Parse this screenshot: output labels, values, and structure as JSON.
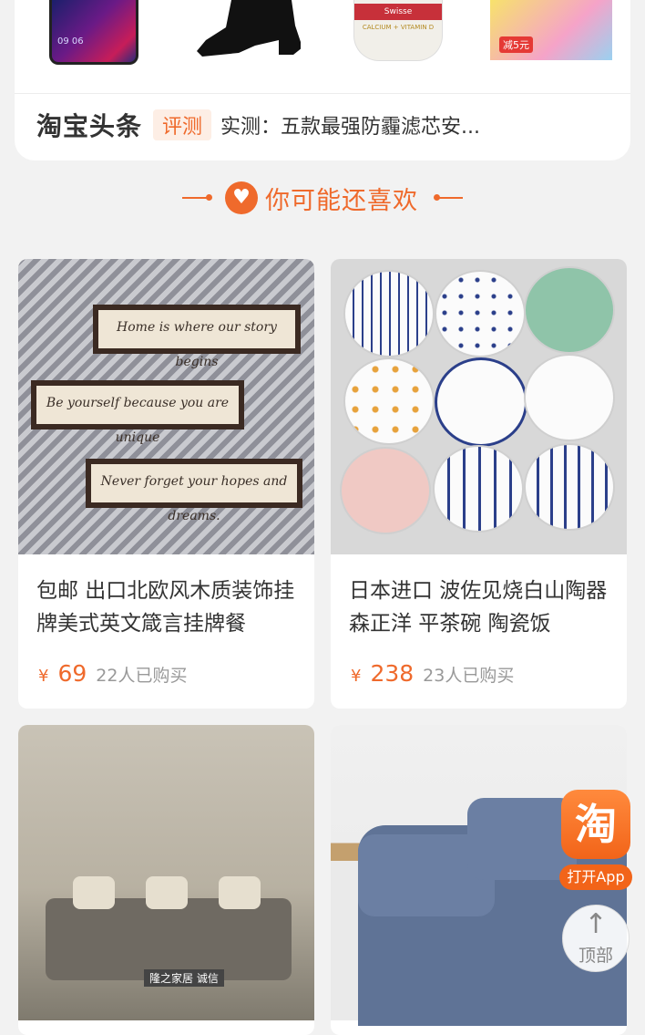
{
  "top_card": {
    "thumbnails": [
      {
        "name": "phone",
        "label": "09 06"
      },
      {
        "name": "boot",
        "label": ""
      },
      {
        "name": "supplement",
        "label": "Swisse",
        "sublabel": "CALCIUM + VITAMIN D"
      },
      {
        "name": "toy",
        "label": "减5元"
      }
    ],
    "brand": "淘宝头条",
    "tag": "评测",
    "headline": "实测：五款最强防霾滤芯安..."
  },
  "section": {
    "title": "你可能还喜欢",
    "heart_icon": "♥"
  },
  "products": [
    {
      "title": "包邮 出口北欧风木质装饰挂牌美式英文箴言挂牌餐",
      "currency": "¥",
      "price": "69",
      "sold": "22人已购买",
      "image_texts": [
        "Home is where our story begins",
        "Be yourself because you are unique",
        "Never forget your hopes and dreams."
      ]
    },
    {
      "title": "日本进口 波佐见烧白山陶器 森正洋 平茶碗 陶瓷饭",
      "currency": "¥",
      "price": "238",
      "sold": "23人已购买"
    },
    {
      "title": "",
      "watermark": "隆之家居 诚信"
    },
    {
      "title": ""
    }
  ],
  "floating": {
    "app_logo": "淘",
    "app_label": "打开App",
    "top_arrow": "↑",
    "top_label": "顶部"
  },
  "colors": {
    "accent": "#ef6a2c",
    "background": "#f2f2f2",
    "app_orange": "#f26419"
  }
}
